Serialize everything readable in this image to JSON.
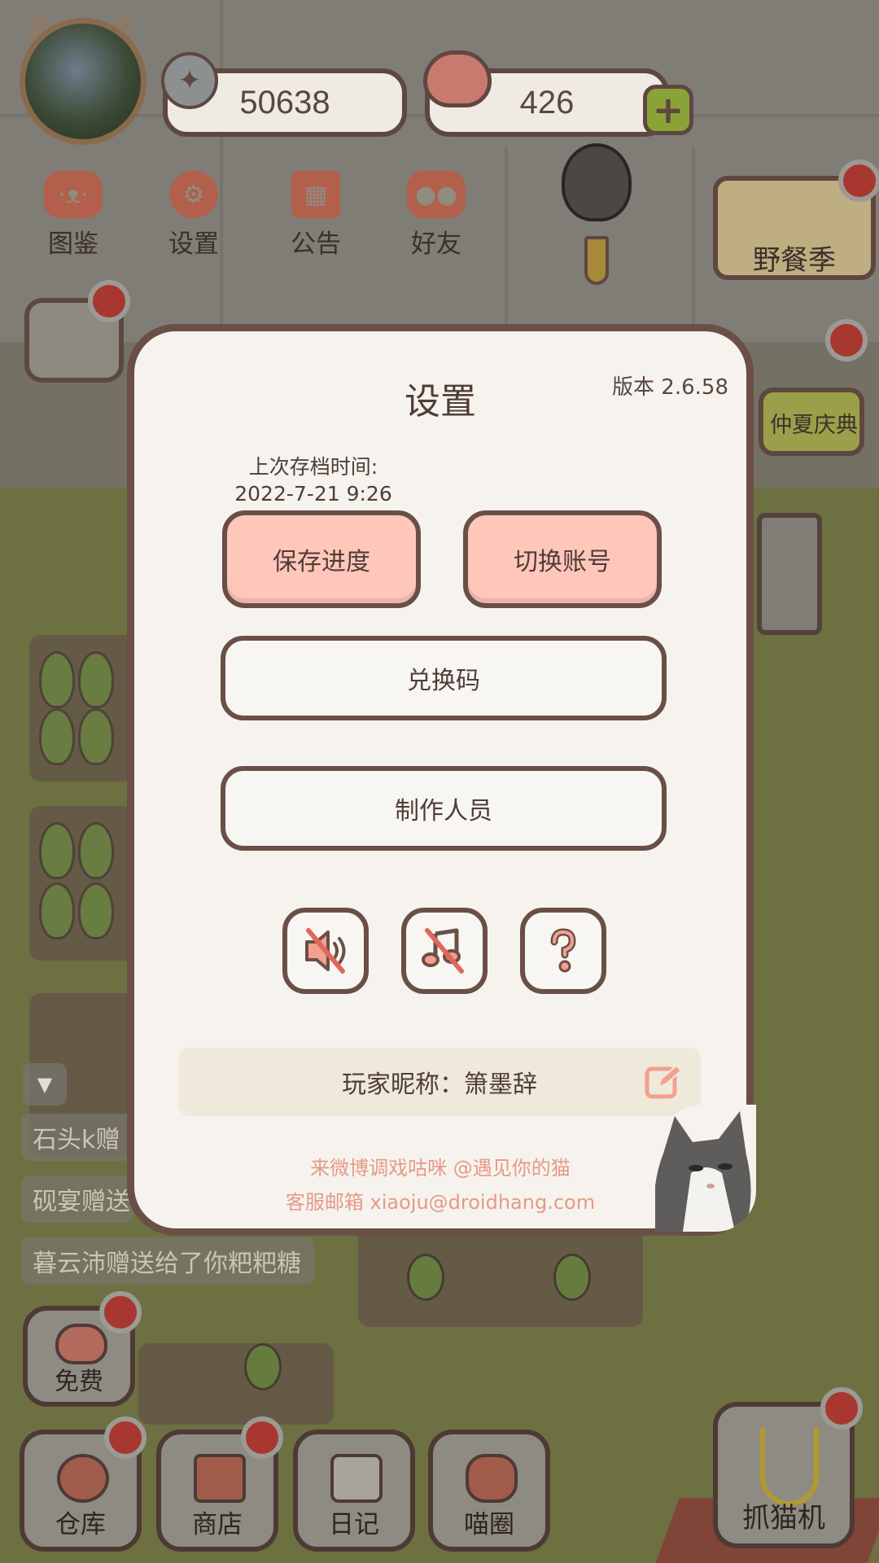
{
  "hud": {
    "coins": "50638",
    "hearts": "426"
  },
  "topnav": [
    {
      "label": "图鉴",
      "icon": "cat-face-icon"
    },
    {
      "label": "设置",
      "icon": "gear-icon"
    },
    {
      "label": "公告",
      "icon": "gift-icon"
    },
    {
      "label": "好友",
      "icon": "friends-icon"
    }
  ],
  "events": {
    "picnic": "野餐季",
    "summer": "仲夏庆典"
  },
  "chat": [
    "石头k赠",
    "砚宴赠送",
    "暮云沛赠送给了你粑粑糖"
  ],
  "bottom_nav": {
    "free": "免费",
    "warehouse": "仓库",
    "shop": "商店",
    "diary": "日记",
    "circle": "喵圈",
    "claw": "抓猫机"
  },
  "settings": {
    "title": "设置",
    "version": "版本 2.6.58",
    "last_save_label": "上次存档时间:",
    "last_save_time": "2022-7-21 9:26",
    "save_button": "保存进度",
    "switch_button": "切换账号",
    "redeem_button": "兑换码",
    "credits_button": "制作人员",
    "nickname": "玩家昵称：箫墨辞",
    "weibo": "来微博调戏咕咪 @遇见你的猫",
    "email": "客服邮箱 xiaoju@droidhang.com"
  },
  "colors": {
    "modal_bg": "#f6f3ee",
    "modal_border": "#6a4f47",
    "pink_button": "#ffc7ba",
    "footer_text": "#e59a86",
    "mute_slash": "#e0685a"
  }
}
